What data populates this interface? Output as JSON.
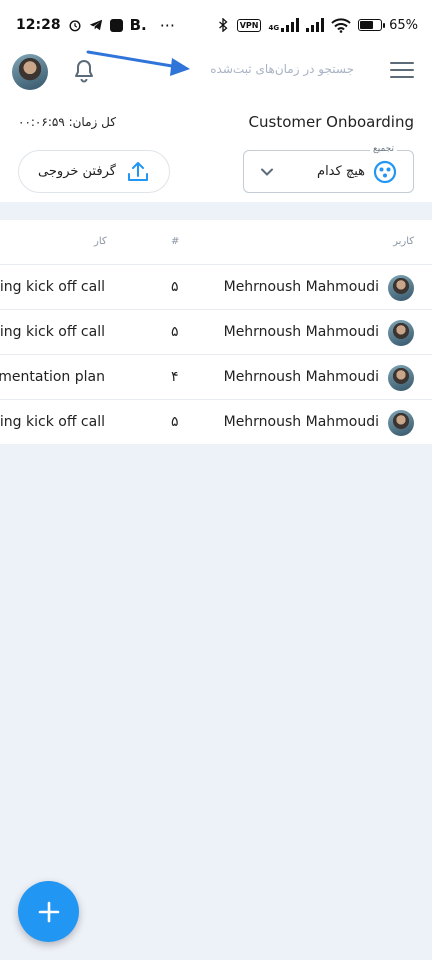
{
  "status_bar": {
    "time": "12:28",
    "b_label": "B.",
    "dots": "···",
    "vpn": "VPN",
    "network": "4G",
    "battery": "65%",
    "battery_level": 0.65
  },
  "header": {
    "search_placeholder": "جستجو در زمان‌های ثبت‌شده",
    "total_time": "کل زمان: ۰۰:۰۶:۵۹",
    "project": "Customer Onboarding",
    "export_label": "گرفتن خروجی",
    "group_legend": "تجمیع",
    "group_value": "هیچ کدام"
  },
  "table": {
    "headers": {
      "user": "کاربر",
      "count": "#",
      "task": "کار"
    },
    "rows": [
      {
        "user": "Mehrnoush Mahmoudi",
        "count": "۵",
        "task": "ing kick off call"
      },
      {
        "user": "Mehrnoush Mahmoudi",
        "count": "۵",
        "task": "ing kick off call"
      },
      {
        "user": "Mehrnoush Mahmoudi",
        "count": "۴",
        "task": "mentation plan"
      },
      {
        "user": "Mehrnoush Mahmoudi",
        "count": "۵",
        "task": "ing kick off call"
      }
    ]
  },
  "fab": {
    "icon": "plus-icon"
  },
  "colors": {
    "accent": "#2196f3",
    "background": "#edf1f8",
    "arrow": "#2f74d8"
  }
}
